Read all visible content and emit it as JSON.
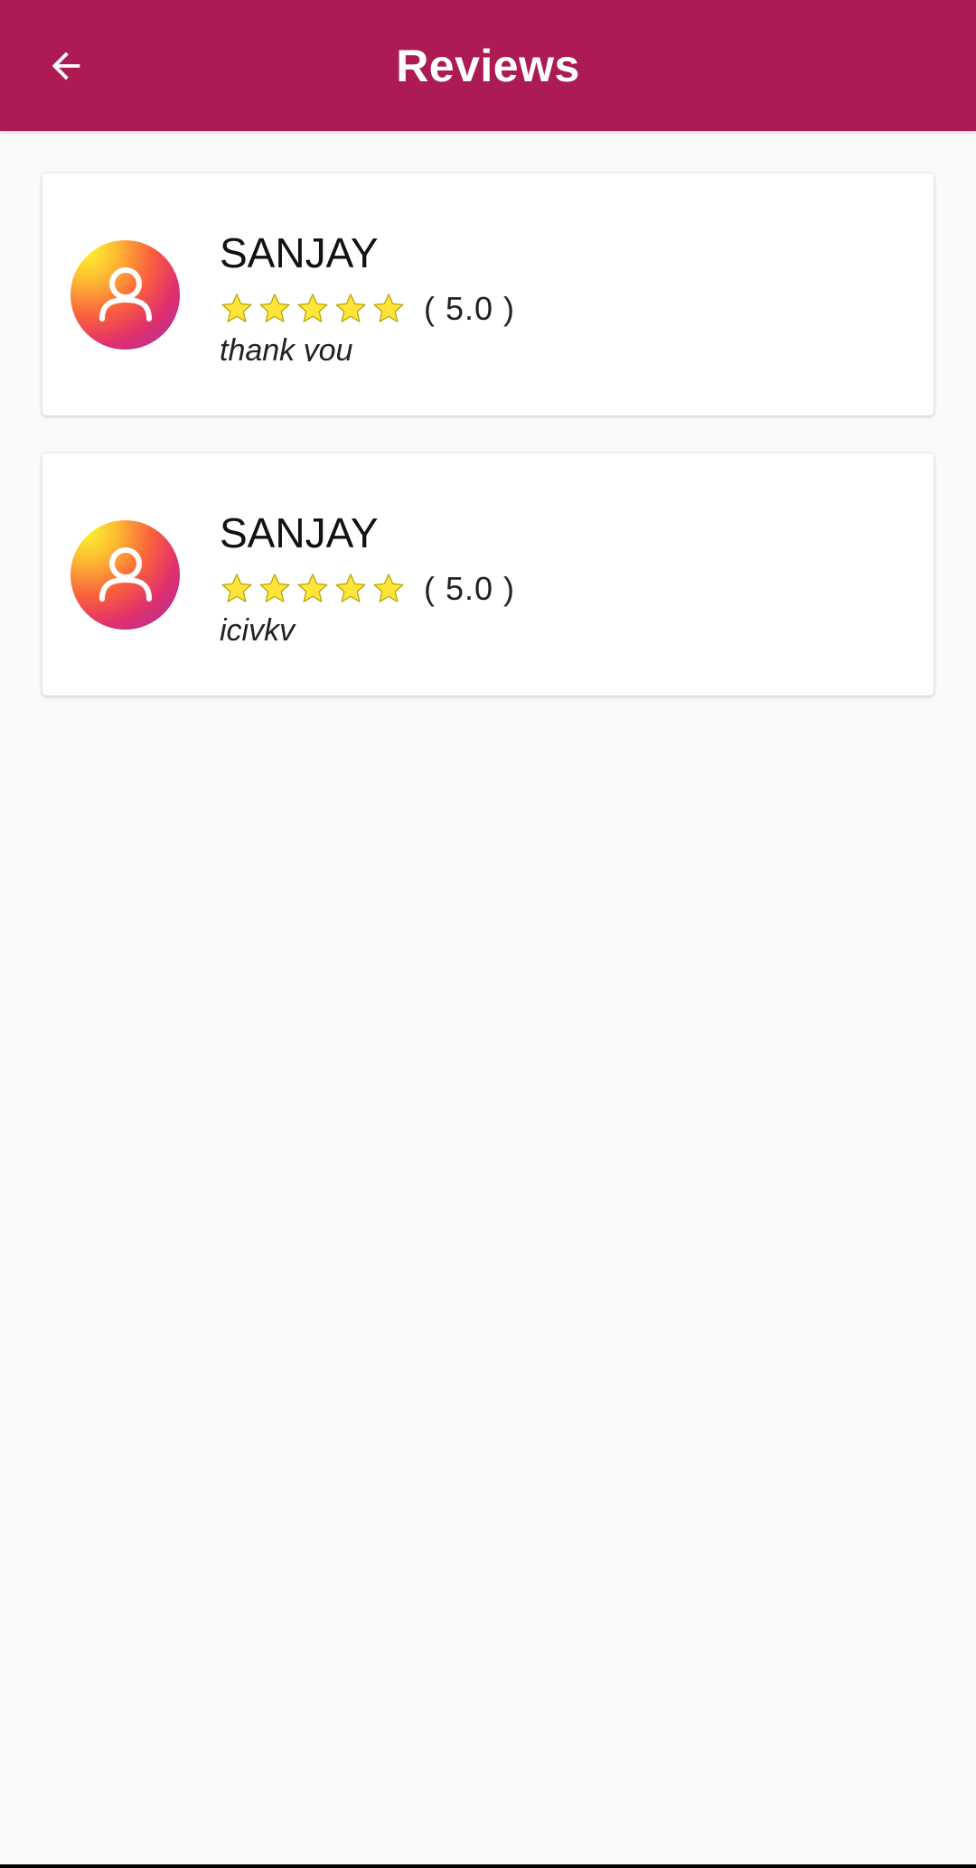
{
  "colors": {
    "app_bar": "#ad1b54",
    "star_fill": "#ffe53a",
    "star_stroke": "#b8a400"
  },
  "header": {
    "title": "Reviews",
    "back_icon": "arrow-left-icon"
  },
  "reviews": [
    {
      "name": "SANJAY",
      "avatar_icon": "user-icon",
      "stars": 5,
      "rating_label": "( 5.0 )",
      "text": "thank you"
    },
    {
      "name": "SANJAY",
      "avatar_icon": "user-icon",
      "stars": 5,
      "rating_label": "( 5.0 )",
      "text": "icivkv"
    }
  ]
}
